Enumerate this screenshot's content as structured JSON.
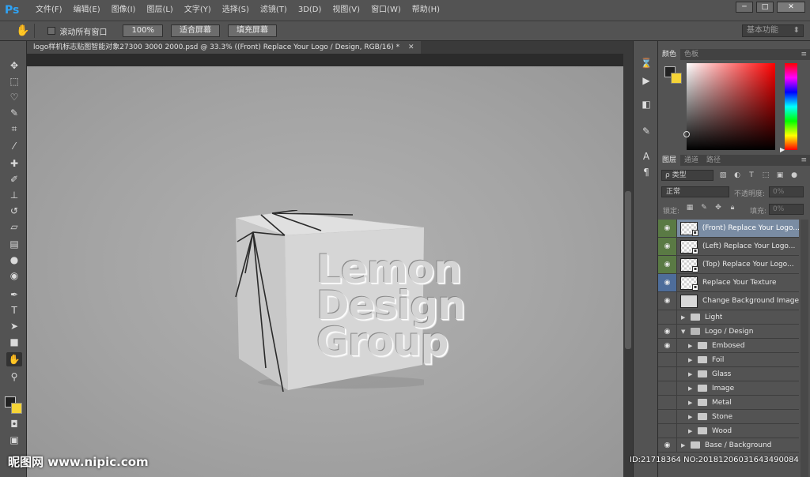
{
  "app": {
    "logo_text": "Ps",
    "menus": [
      "文件(F)",
      "编辑(E)",
      "图像(I)",
      "图层(L)",
      "文字(Y)",
      "选择(S)",
      "滤镜(T)",
      "3D(D)",
      "视图(V)",
      "窗口(W)",
      "帮助(H)"
    ],
    "window_controls": [
      "─",
      "□",
      "✕"
    ]
  },
  "options": {
    "scroll_all_label": "滚动所有窗口",
    "btn_zoom": "100%",
    "btn_fit": "适合屏幕",
    "btn_fill": "填充屏幕",
    "workspace": "基本功能"
  },
  "document": {
    "tab_title": "logo样机标志贴图智能对象27300 3000 2000.psd @ 33.3% ((Front) Replace Your Logo / Design, RGB/16) *",
    "close": "✕",
    "cube_lines": [
      "Lemon",
      "Design",
      "Group"
    ]
  },
  "panels": {
    "color_tabs": [
      "颜色",
      "色板"
    ],
    "layer_tabs": [
      "图层",
      "通道",
      "路径"
    ],
    "filter_kind": "ρ 类型",
    "blend_mode": "正常",
    "opacity_label": "不透明度:",
    "opacity_value": "0%",
    "lock_label": "锁定:",
    "fill_label": "填充:",
    "fill_value": "0%",
    "menu_glyph": "≡"
  },
  "layers": [
    {
      "name": "(Front) Replace Your Logo...",
      "visible": true,
      "kind": "smart",
      "state": "selected"
    },
    {
      "name": "(Left) Replace Your Logo...",
      "visible": true,
      "kind": "smart",
      "state": "green"
    },
    {
      "name": "(Top) Replace Your Logo...",
      "visible": true,
      "kind": "smart",
      "state": "green"
    },
    {
      "name": "Replace Your Texture",
      "visible": true,
      "kind": "smart",
      "state": "blue"
    },
    {
      "name": "Change Background Image",
      "visible": true,
      "kind": "solid",
      "state": "normal"
    },
    {
      "name": "Light",
      "visible": false,
      "kind": "folder",
      "expanded": false,
      "indent": 0
    },
    {
      "name": "Logo / Design",
      "visible": true,
      "kind": "folder",
      "expanded": true,
      "indent": 0
    },
    {
      "name": "Embosed",
      "visible": true,
      "kind": "folder",
      "expanded": false,
      "indent": 1
    },
    {
      "name": "Foil",
      "visible": false,
      "kind": "folder",
      "expanded": false,
      "indent": 1
    },
    {
      "name": "Glass",
      "visible": false,
      "kind": "folder",
      "expanded": false,
      "indent": 1
    },
    {
      "name": "Image",
      "visible": false,
      "kind": "folder",
      "expanded": false,
      "indent": 1
    },
    {
      "name": "Metal",
      "visible": false,
      "kind": "folder",
      "expanded": false,
      "indent": 1
    },
    {
      "name": "Stone",
      "visible": false,
      "kind": "folder",
      "expanded": false,
      "indent": 1
    },
    {
      "name": "Wood",
      "visible": false,
      "kind": "folder",
      "expanded": false,
      "indent": 1
    },
    {
      "name": "Base / Background",
      "visible": true,
      "kind": "folder",
      "expanded": false,
      "indent": 0
    }
  ],
  "watermark": {
    "left": "昵图网 www.nipic.com",
    "right": "ID:21718364 NO:20181206031643490084"
  }
}
